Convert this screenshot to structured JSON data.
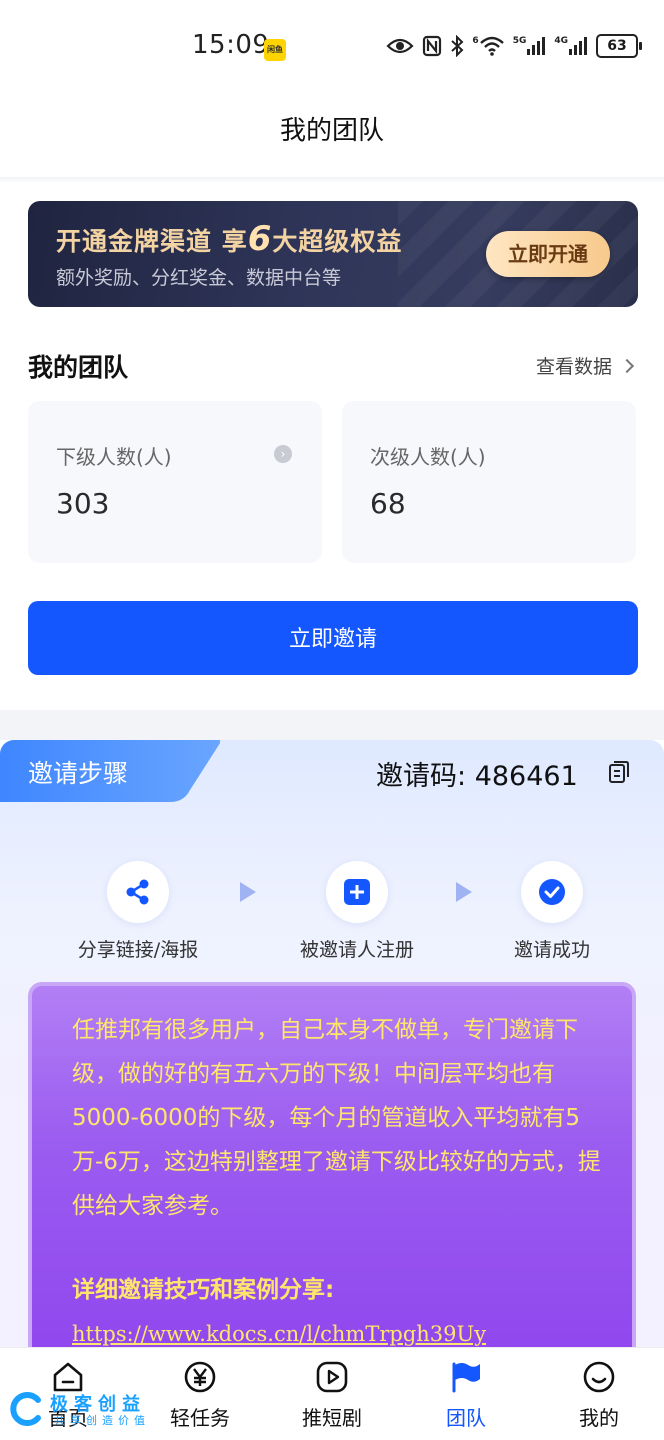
{
  "status_bar": {
    "time": "15:09",
    "app_badge": "闲鱼",
    "signal_5g": "5G",
    "signal_4g": "4G",
    "wifi_num": "6",
    "battery": "63"
  },
  "header": {
    "title": "我的团队"
  },
  "promo": {
    "title_before": "开通金牌渠道 享",
    "title_num": "6",
    "title_after": "大超级权益",
    "subtitle": "额外奖励、分红奖金、数据中台等",
    "button": "立即开通"
  },
  "team": {
    "heading": "我的团队",
    "view_data": "查看数据",
    "stats": [
      {
        "label": "下级人数(人)",
        "value": "303"
      },
      {
        "label": "次级人数(人)",
        "value": "68"
      }
    ],
    "invite_button": "立即邀请"
  },
  "steps": {
    "tab": "邀请步骤",
    "invite_code_label": "邀请码:",
    "invite_code": "486461",
    "items": [
      {
        "label": "分享链接/海报",
        "icon": "share-icon"
      },
      {
        "label": "被邀请人注册",
        "icon": "plus-icon"
      },
      {
        "label": "邀请成功",
        "icon": "check-icon"
      }
    ]
  },
  "notice": {
    "text": "任推邦有很多用户，自己本身不做单，专门邀请下级，做的好的有五六万的下级！中间层平均也有5000-6000的下级，每个月的管道收入平均就有5万-6万，这边特别整理了邀请下级比较好的方式，提供给大家参考。",
    "link_title": "详细邀请技巧和案例分享:",
    "link": "https://www.kdocs.cn/l/chmTrpgh39Uy"
  },
  "bottom_nav": [
    {
      "label": "首页",
      "icon": "home-icon",
      "active": false
    },
    {
      "label": "轻任务",
      "icon": "yen-icon",
      "active": false
    },
    {
      "label": "推短剧",
      "icon": "play-icon",
      "active": false
    },
    {
      "label": "团队",
      "icon": "flag-icon",
      "active": true
    },
    {
      "label": "我的",
      "icon": "smile-icon",
      "active": false
    }
  ],
  "watermark": {
    "title": "极客创益",
    "subtitle": "共享创造价值"
  },
  "colors": {
    "primary": "#1557ff",
    "promo_bg": "#2f3558",
    "gold": "#f3d3a1",
    "purple": "#9b5cf0",
    "notice_text": "#ffe66b"
  }
}
